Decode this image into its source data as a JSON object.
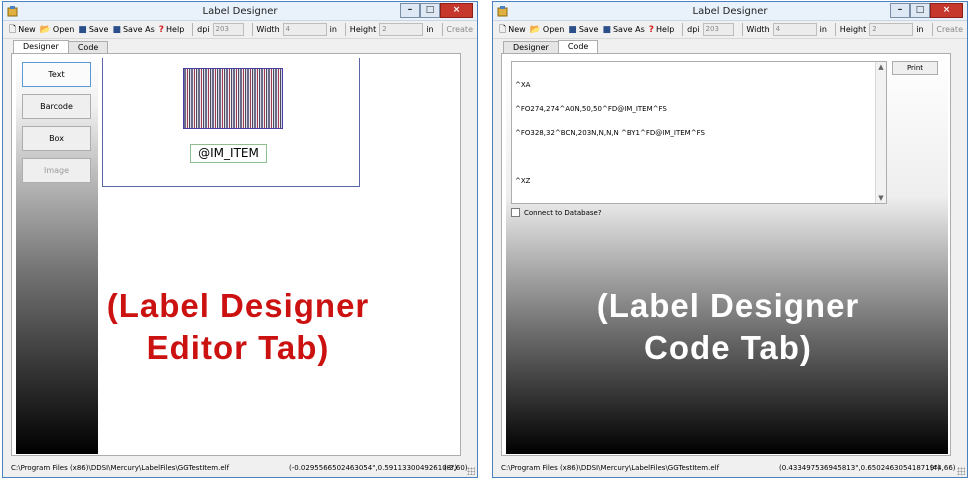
{
  "windows": [
    {
      "title": "Label Designer",
      "toolbar": {
        "new_label": "New",
        "open_label": "Open",
        "save_label": "Save",
        "save_as_label": "Save As",
        "help_label": "Help",
        "dpi_label": "dpi",
        "dpi_value": "203",
        "width_label": "Width",
        "width_value": "4",
        "width_unit": "in",
        "height_label": "Height",
        "height_value": "2",
        "height_unit": "in",
        "create_label": "Create"
      },
      "tabs": [
        "Designer",
        "Code"
      ],
      "active_tab": "Designer",
      "tools": [
        "Text",
        "Barcode",
        "Box",
        "Image"
      ],
      "canvas": {
        "barcode_field_text": "@IM_ITEM"
      },
      "status": {
        "path": "C:\\Program Files (x86)\\DDSI\\Mercury\\LabelFiles\\GGTestItem.elf",
        "coords": "(-0.0295566502463054\",0.591133004926108\")",
        "position": "(-3,60)"
      }
    },
    {
      "title": "Label Designer",
      "toolbar": {
        "new_label": "New",
        "open_label": "Open",
        "save_label": "Save",
        "save_as_label": "Save As",
        "help_label": "Help",
        "dpi_label": "dpi",
        "dpi_value": "203",
        "width_label": "Width",
        "width_value": "4",
        "width_unit": "in",
        "height_label": "Height",
        "height_value": "2",
        "height_unit": "in",
        "create_label": "Create"
      },
      "tabs": [
        "Designer",
        "Code"
      ],
      "active_tab": "Code",
      "code": {
        "lines": [
          "^XA",
          "^FO274,274^A0N,50,50^FD@IM_ITEM^FS",
          "^FO328,32^BCN,203N,N,N,N ^BY1^FD@IM_ITEM^FS",
          "",
          "^XZ"
        ],
        "print_label": "Print",
        "connect_label": "Connect to Database?"
      },
      "status": {
        "path": "C:\\Program Files (x86)\\DDSI\\Mercury\\LabelFiles\\GGTestItem.elf",
        "coords": "(0.433497536945813\",0.650246305418719\")",
        "position": "(44,66)"
      }
    }
  ],
  "annotations": {
    "left": [
      "(Label Designer",
      "Editor Tab)"
    ],
    "right": [
      "(Label Designer",
      "Code Tab)"
    ]
  },
  "colors": {
    "annotation_red": "#cc1111",
    "annotation_white": "#ffffff",
    "window_border": "#4a7fc0",
    "close_button": "#c7382c"
  }
}
